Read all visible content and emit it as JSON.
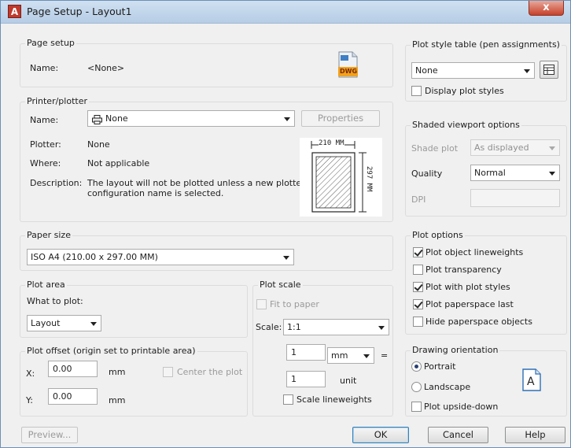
{
  "window": {
    "title": "Page Setup - Layout1",
    "close_label": "x",
    "app_icon_text": "A"
  },
  "page_setup": {
    "group_label": "Page setup",
    "name_label": "Name:",
    "name_value": "<None>",
    "dwg_badge": "DWG"
  },
  "printer": {
    "group_label": "Printer/plotter",
    "name_label": "Name:",
    "name_value": "None",
    "properties_label": "Properties",
    "plotter_label": "Plotter:",
    "plotter_value": "None",
    "where_label": "Where:",
    "where_value": "Not applicable",
    "description_label": "Description:",
    "description_line1": "The layout will not be plotted unless a new plotter",
    "description_line2": "configuration name is selected.",
    "preview_width": "210 MM",
    "preview_height": "297 MM"
  },
  "paper_size": {
    "group_label": "Paper size",
    "value": "ISO A4 (210.00 x 297.00 MM)"
  },
  "plot_area": {
    "group_label": "Plot area",
    "what_label": "What to plot:",
    "what_value": "Layout"
  },
  "plot_offset": {
    "group_label": "Plot offset (origin set to printable area)",
    "x_label": "X:",
    "x_value": "0.00",
    "x_unit": "mm",
    "y_label": "Y:",
    "y_value": "0.00",
    "y_unit": "mm",
    "center_label": "Center the plot"
  },
  "plot_scale": {
    "group_label": "Plot scale",
    "fit_label": "Fit to paper",
    "scale_label": "Scale:",
    "scale_value": "1:1",
    "value1": "1",
    "unit_value": "mm",
    "equals": "=",
    "value2": "1",
    "unit_label": "unit",
    "lineweights_label": "Scale lineweights"
  },
  "plot_style": {
    "group_label": "Plot style table (pen assignments)",
    "value": "None",
    "display_label": "Display plot styles"
  },
  "shaded": {
    "group_label": "Shaded viewport options",
    "shade_label": "Shade plot",
    "shade_value": "As displayed",
    "quality_label": "Quality",
    "quality_value": "Normal",
    "dpi_label": "DPI"
  },
  "plot_options": {
    "group_label": "Plot options",
    "opt1": "Plot object lineweights",
    "opt2": "Plot transparency",
    "opt3": "Plot with plot styles",
    "opt4": "Plot paperspace last",
    "opt5": "Hide paperspace objects"
  },
  "orientation": {
    "group_label": "Drawing orientation",
    "portrait": "Portrait",
    "landscape": "Landscape",
    "upside_down": "Plot upside-down",
    "page_glyph": "A"
  },
  "footer": {
    "preview": "Preview...",
    "ok": "OK",
    "cancel": "Cancel",
    "help": "Help"
  }
}
